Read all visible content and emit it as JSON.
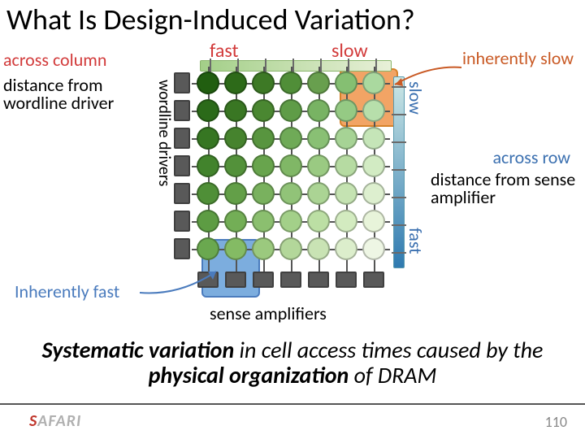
{
  "title": "What Is Design-Induced Variation?",
  "labels": {
    "across_column": "across column",
    "fast_top": "fast",
    "slow_top": "slow",
    "inherently_slow": "inherently slow",
    "dist_wordline_1": "distance from",
    "dist_wordline_2": "wordline driver",
    "wordline_drivers": "wordline drivers",
    "slow_right": "slow",
    "fast_right": "fast",
    "across_row": "across row",
    "dist_sense": "distance from sense amplifier",
    "inherently_fast": "Inherently fast",
    "sense_amplifiers": "sense amplifiers"
  },
  "conclusion": {
    "part1": "Systematic variation",
    "part2": " in cell access times caused by the ",
    "part3": "physical organization",
    "part4": " of DRAM"
  },
  "footer": {
    "logo_s": "S",
    "logo_rest": "AFARI",
    "page": "110"
  },
  "grid": {
    "rows": 7,
    "cols": 7,
    "cell_spacing": 34,
    "cell_colors": [
      [
        "#6aa84f",
        "#84bb64",
        "#9bc97e",
        "#b3d79a",
        "#c9e3b4",
        "#dceecc",
        "#eef6e4"
      ],
      [
        "#5d9c43",
        "#73ae56",
        "#8bbf6f",
        "#a3d089",
        "#bcdfa4",
        "#d3ebc0",
        "#e8f4da"
      ],
      [
        "#4f8f37",
        "#639f48",
        "#79b15e",
        "#91c378",
        "#abd494",
        "#c5e3b2",
        "#ddefcf"
      ],
      [
        "#42832c",
        "#53913a",
        "#68a44d",
        "#80b766",
        "#9aca82",
        "#b6dba2",
        "#d2ebc3"
      ],
      [
        "#367622",
        "#46832e",
        "#58953f",
        "#6faa57",
        "#89c074",
        "#a6d395",
        "#c5e5b8"
      ],
      [
        "#2b6a19",
        "#397623",
        "#4a8731",
        "#5f9c47",
        "#78b363",
        "#95ca84",
        "#b7dfab"
      ],
      [
        "#215e10",
        "#2d6a19",
        "#3d7925",
        "#508e38",
        "#689f4e",
        "#85bf72",
        "#aad99f"
      ]
    ]
  }
}
